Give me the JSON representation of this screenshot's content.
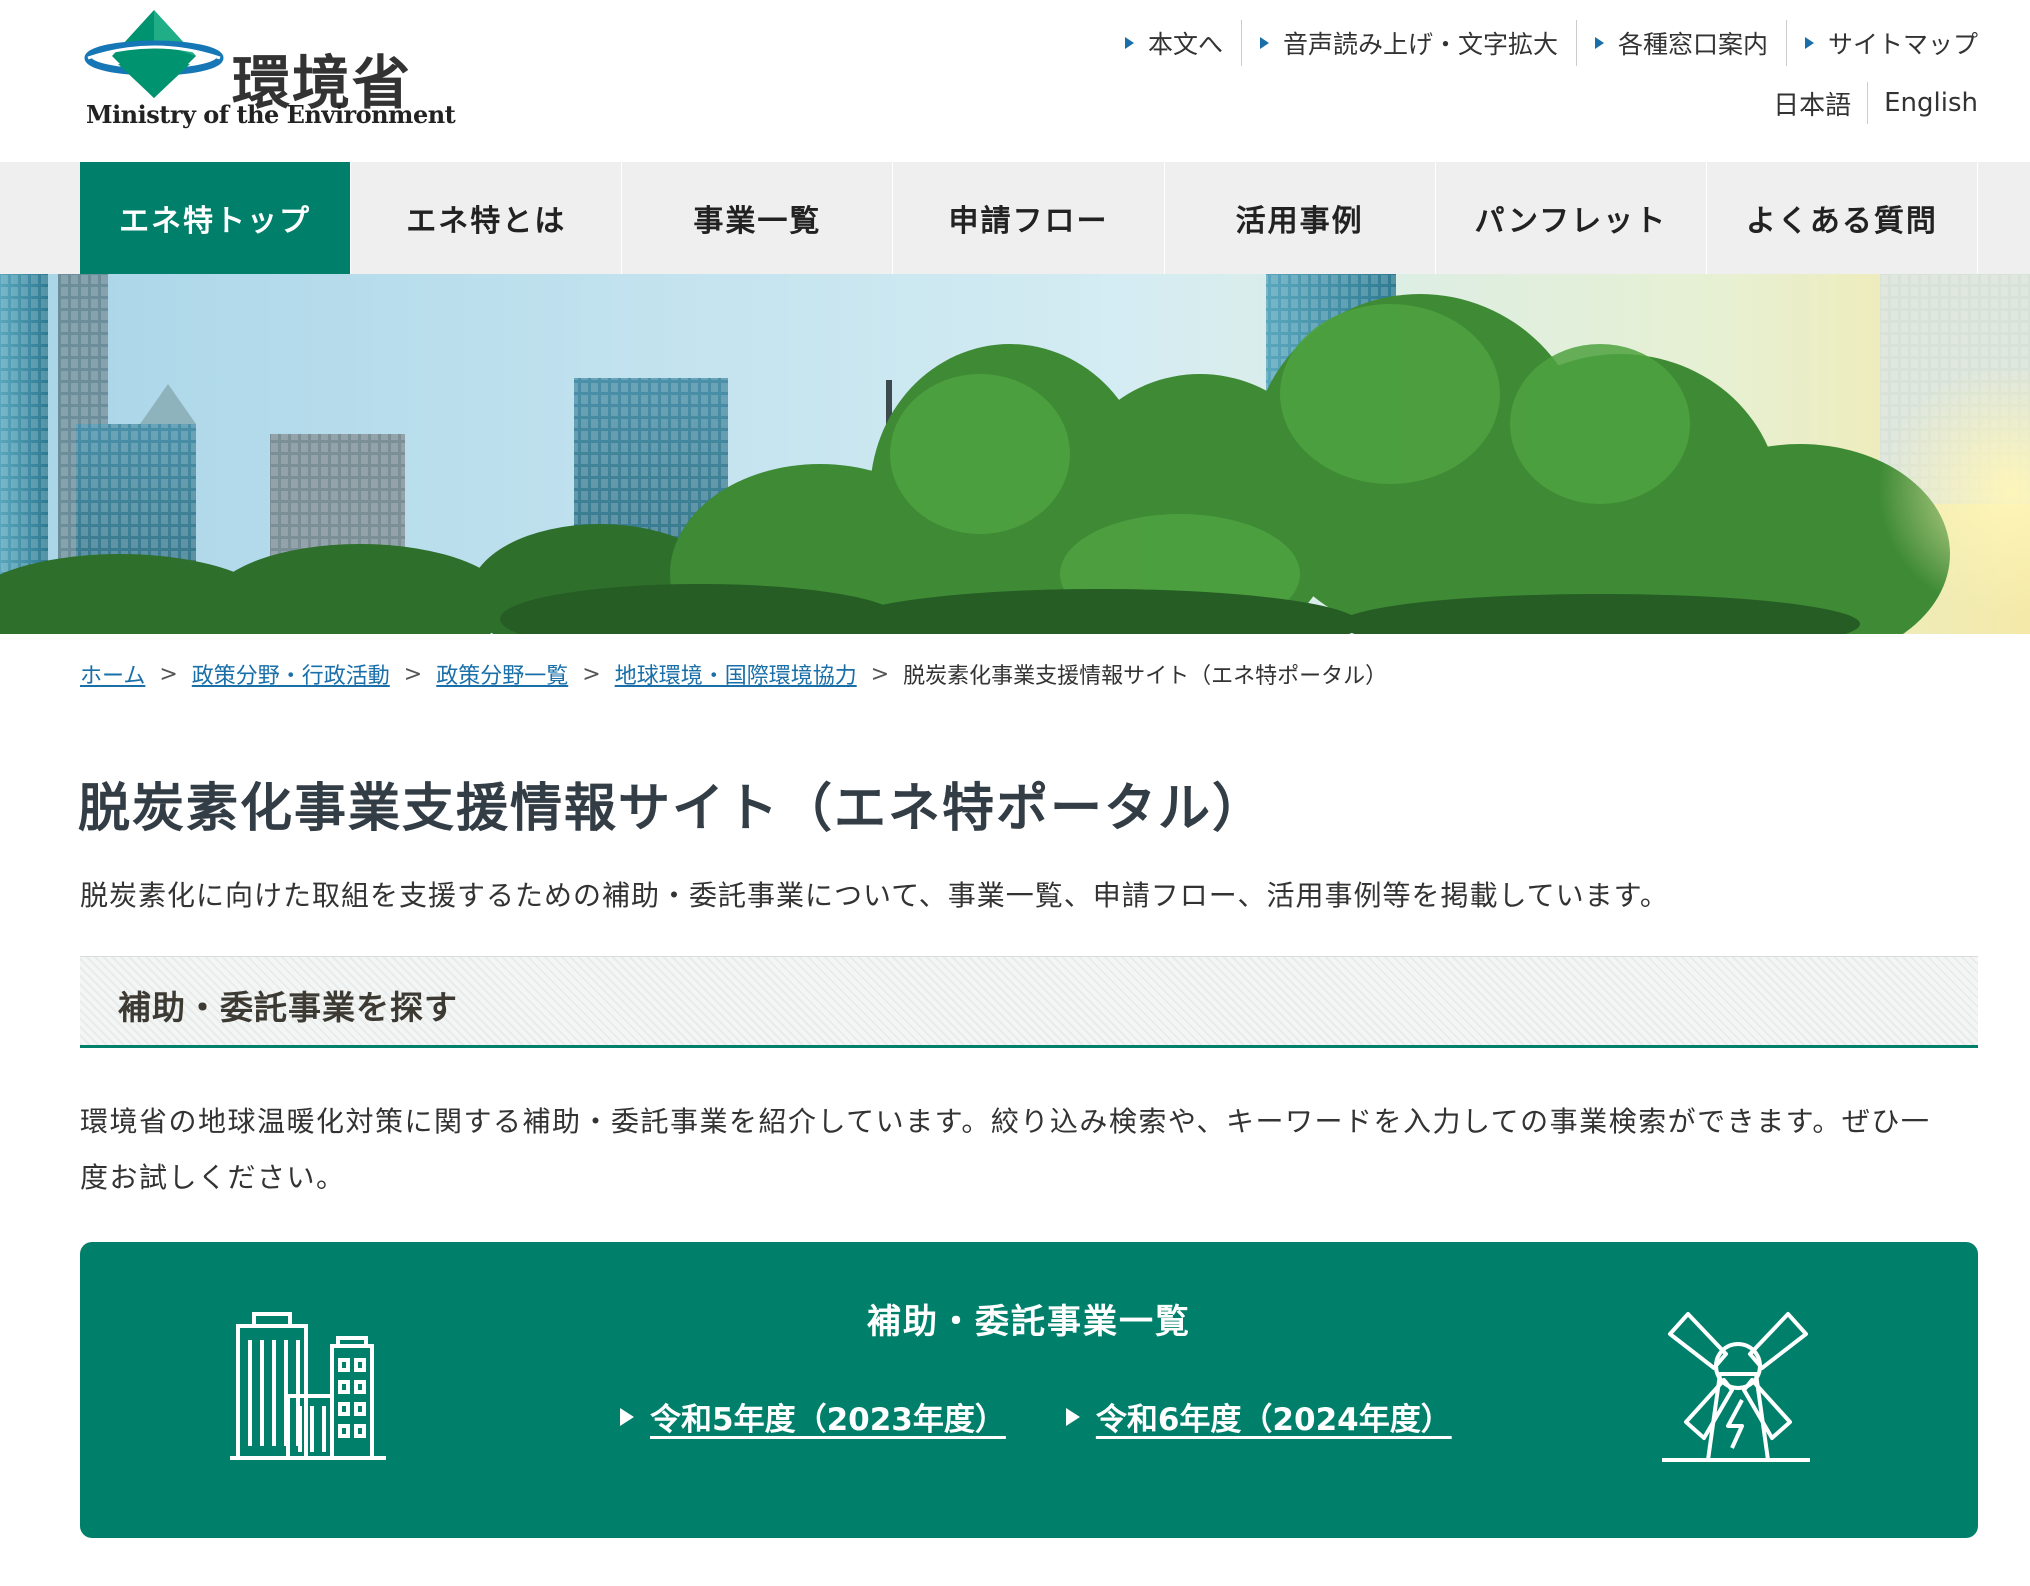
{
  "header": {
    "logo_jp": "環境省",
    "logo_en": "Ministry of the Environment",
    "utility_links": [
      {
        "label": "本文へ"
      },
      {
        "label": "音声読み上げ・文字拡大"
      },
      {
        "label": "各種窓口案内"
      },
      {
        "label": "サイトマップ"
      }
    ],
    "languages": [
      {
        "label": "日本語"
      },
      {
        "label": "English"
      }
    ]
  },
  "gnav": {
    "items": [
      {
        "label": "エネ特トップ",
        "active": true
      },
      {
        "label": "エネ特とは"
      },
      {
        "label": "事業一覧"
      },
      {
        "label": "申請フロー"
      },
      {
        "label": "活用事例"
      },
      {
        "label": "パンフレット"
      },
      {
        "label": "よくある質問"
      }
    ]
  },
  "breadcrumb": {
    "items": [
      {
        "label": "ホーム"
      },
      {
        "label": "政策分野・行政活動"
      },
      {
        "label": "政策分野一覧"
      },
      {
        "label": "地球環境・国際環境協力"
      }
    ],
    "separator": ">",
    "current": "脱炭素化事業支援情報サイト（エネ特ポータル）"
  },
  "page": {
    "title": "脱炭素化事業支援情報サイト（エネ特ポータル）",
    "lead": "脱炭素化に向けた取組を支援するための補助・委託事業について、事業一覧、申請フロー、活用事例等を掲載しています。"
  },
  "section": {
    "heading": "補助・委託事業を探す",
    "body": "環境省の地球温暖化対策に関する補助・委託事業を紹介しています。絞り込み検索や、キーワードを入力しての事業検索ができます。ぜひ一度お試しください。"
  },
  "card": {
    "title": "補助・委託事業一覧",
    "links": [
      {
        "label": "令和5年度（2023年度）"
      },
      {
        "label": "令和6年度（2024年度）"
      }
    ],
    "left_icon": "buildings-icon",
    "right_icon": "windmill-icon"
  },
  "colors": {
    "brand_green": "#00806b",
    "link_blue": "#1a6fa8",
    "nav_bg": "#efefef"
  }
}
